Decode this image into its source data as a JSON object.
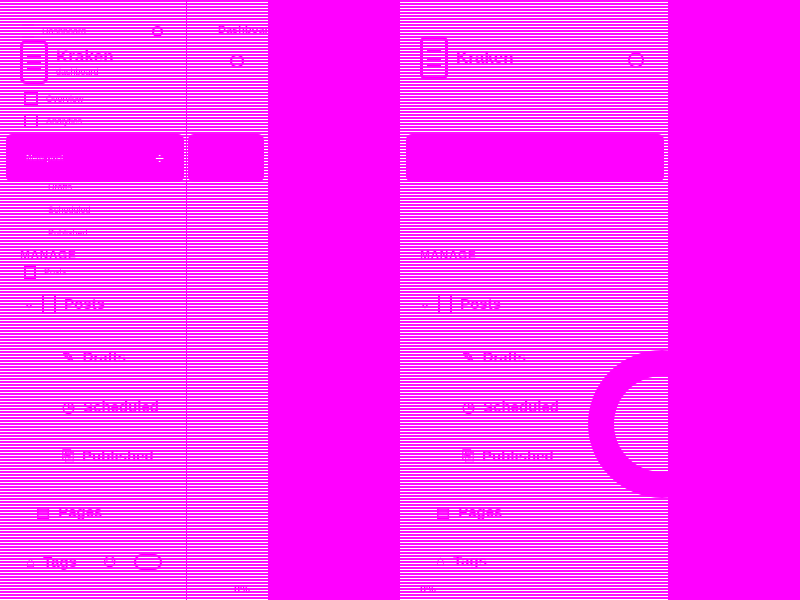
{
  "brand": {
    "name": "Kraken",
    "subtitle": "dashboard"
  },
  "header_dots": "Dashboard",
  "nav_top": [
    {
      "label": "Overview",
      "icon": "grid-icon"
    },
    {
      "label": "Analytics",
      "icon": "chart-icon"
    }
  ],
  "new_post": {
    "label": "New post",
    "plus": "+"
  },
  "sub_items": [
    "Drafts",
    "Scheduled",
    "Published"
  ],
  "manage": {
    "title": "MANAGE"
  },
  "menu": [
    {
      "label": "Posts",
      "icon": "document-icon"
    },
    {
      "label": "Drafts",
      "icon": "pencil-icon"
    },
    {
      "label": "Scheduled",
      "icon": "clock-icon"
    },
    {
      "label": "Published",
      "icon": "published-icon"
    },
    {
      "label": "Pages",
      "icon": "pages-icon"
    },
    {
      "label": "Tags",
      "icon": "tag-icon"
    }
  ],
  "progress_percent": "0%",
  "colors": {
    "accent": "#ff00ff",
    "background": "#ffffff"
  }
}
